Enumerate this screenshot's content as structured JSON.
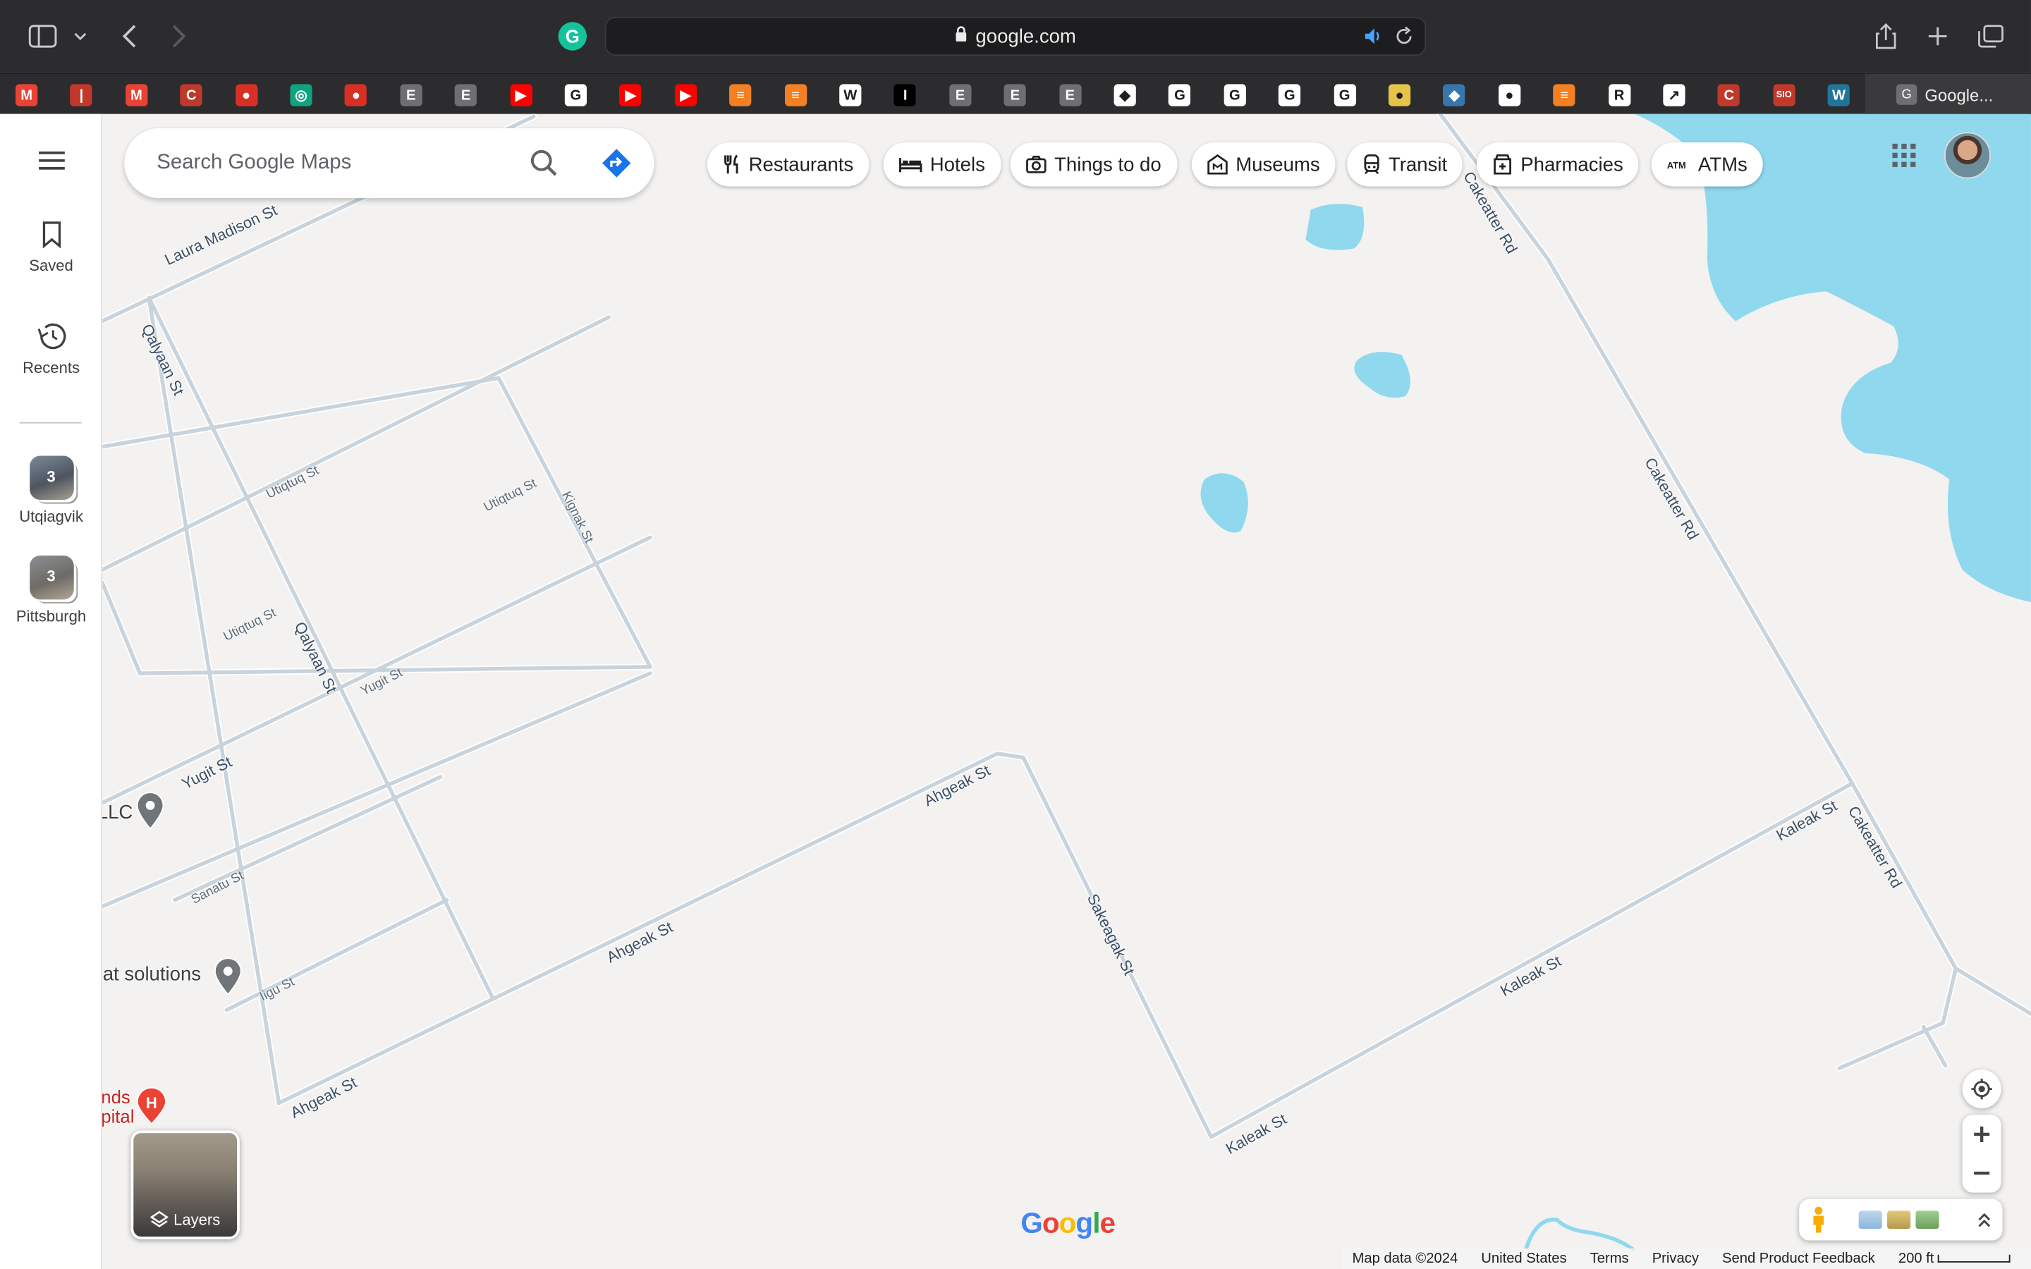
{
  "browser": {
    "url": "google.com",
    "favorites": [
      {
        "icon": "gmail-icon",
        "glyph": "M",
        "color": "#ea4335"
      },
      {
        "icon": "bookmark-icon",
        "glyph": "|",
        "color": "#c0392b"
      },
      {
        "icon": "gmail-icon",
        "glyph": "M",
        "color": "#ea4335"
      },
      {
        "icon": "c-icon",
        "glyph": "C",
        "color": "#c0392b"
      },
      {
        "icon": "red-circle-icon",
        "glyph": "●",
        "color": "#d93025"
      },
      {
        "icon": "openai-icon",
        "glyph": "◎",
        "color": "#10a37f"
      },
      {
        "icon": "red-circle-icon",
        "glyph": "●",
        "color": "#d93025"
      },
      {
        "icon": "e-icon",
        "glyph": "E",
        "color": "#6e6e73"
      },
      {
        "icon": "e-icon",
        "glyph": "E",
        "color": "#6e6e73"
      },
      {
        "icon": "youtube-icon",
        "glyph": "▶",
        "color": "#ff0000"
      },
      {
        "icon": "google-icon",
        "glyph": "G",
        "color": "#ffffff"
      },
      {
        "icon": "youtube-icon",
        "glyph": "▶",
        "color": "#ff0000"
      },
      {
        "icon": "youtube-icon",
        "glyph": "▶",
        "color": "#ff0000"
      },
      {
        "icon": "stackoverflow-icon",
        "glyph": "≡",
        "color": "#f48024"
      },
      {
        "icon": "stackoverflow-icon",
        "glyph": "≡",
        "color": "#f48024"
      },
      {
        "icon": "wikipedia-icon",
        "glyph": "W",
        "color": "#ffffff"
      },
      {
        "icon": "i-icon",
        "glyph": "I",
        "color": "#000000"
      },
      {
        "icon": "e-icon",
        "glyph": "E",
        "color": "#6e6e73"
      },
      {
        "icon": "e-icon",
        "glyph": "E",
        "color": "#6e6e73"
      },
      {
        "icon": "e-icon",
        "glyph": "E",
        "color": "#6e6e73"
      },
      {
        "icon": "diamond-icon",
        "glyph": "◆",
        "color": "#ffffff"
      },
      {
        "icon": "google-icon",
        "glyph": "G",
        "color": "#ffffff"
      },
      {
        "icon": "google-icon",
        "glyph": "G",
        "color": "#ffffff"
      },
      {
        "icon": "google-icon",
        "glyph": "G",
        "color": "#ffffff"
      },
      {
        "icon": "google-icon",
        "glyph": "G",
        "color": "#ffffff"
      },
      {
        "icon": "yellow-circle-icon",
        "glyph": "●",
        "color": "#e6c34a"
      },
      {
        "icon": "python-icon",
        "glyph": "◆",
        "color": "#3776ab"
      },
      {
        "icon": "github-icon",
        "glyph": "●",
        "color": "#ffffff"
      },
      {
        "icon": "stackoverflow-icon",
        "glyph": "≡",
        "color": "#f48024"
      },
      {
        "icon": "r-icon",
        "glyph": "R",
        "color": "#ffffff"
      },
      {
        "icon": "chart-icon",
        "glyph": "↗",
        "color": "#ffffff"
      },
      {
        "icon": "c-icon",
        "glyph": "C",
        "color": "#c0392b"
      },
      {
        "icon": "sio-icon",
        "glyph": "SIO",
        "color": "#c0392b"
      },
      {
        "icon": "wordpress-icon",
        "glyph": "W",
        "color": "#21759b"
      }
    ],
    "active_tab": "Google..."
  },
  "rail": {
    "saved": "Saved",
    "recents": "Recents",
    "places": [
      {
        "label": "Utqiagvik",
        "count": "3"
      },
      {
        "label": "Pittsburgh",
        "count": "3"
      }
    ]
  },
  "search": {
    "placeholder": "Search Google Maps"
  },
  "chips": [
    {
      "label": "Restaurants",
      "icon": "fork-knife-icon"
    },
    {
      "label": "Hotels",
      "icon": "bed-icon"
    },
    {
      "label": "Things to do",
      "icon": "camera-icon"
    },
    {
      "label": "Museums",
      "icon": "museum-icon"
    },
    {
      "label": "Transit",
      "icon": "train-icon"
    },
    {
      "label": "Pharmacies",
      "icon": "pharmacy-icon"
    },
    {
      "label": "ATMs",
      "icon": "atm-icon"
    }
  ],
  "map": {
    "streets": {
      "laura_madison": "Laura Madison St",
      "qalyaan_1": "Qalyaan St",
      "qalyaan_2": "Qalyaan St",
      "utiqtuq_1": "Utiqtuq St",
      "utiqtuq_2": "Utiqtuq St",
      "utiqtuq_3": "Utiqtuq St",
      "kignak": "Kignak St",
      "yugit_1": "Yugit St",
      "yugit_2": "Yugit St",
      "sanatu": "Sanatu St",
      "iigu": "Iigu St",
      "ahgeak_1": "Ahgeak St",
      "ahgeak_2": "Ahgeak St",
      "ahgeak_3": "Ahgeak St",
      "sakeagak": "Sakeagak St",
      "kaleak_1": "Kaleak St",
      "kaleak_2": "Kaleak St",
      "kaleak_3": "Kaleak St",
      "cakeatter_1": "Cakeatter Rd",
      "cakeatter_2": "Cakeatter Rd",
      "cakeatter_3": "Cakeatter Rd"
    },
    "pois": {
      "llc": "LLC",
      "iat": "iat solutions",
      "hospital_1": "nds",
      "hospital_2": "pital"
    },
    "layers_label": "Layers",
    "logo": "Google"
  },
  "footer": {
    "map_data": "Map data ©2024",
    "country": "United States",
    "terms": "Terms",
    "privacy": "Privacy",
    "feedback": "Send Product Feedback",
    "scale": "200 ft"
  },
  "colors": {
    "water": "#8fd8ee",
    "road": "#c6d2dd",
    "road_edge": "#ffffff"
  }
}
